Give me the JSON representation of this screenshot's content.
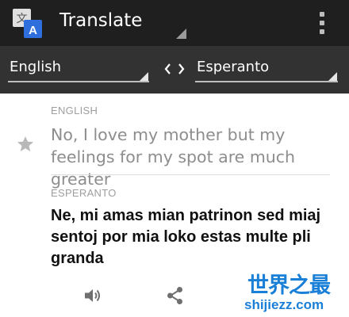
{
  "app_bar": {
    "title": "Translate",
    "icons": {
      "app": "translate-app-icon",
      "overflow": "overflow-menu-icon"
    }
  },
  "language_bar": {
    "source_language": "English",
    "target_language": "Esperanto",
    "swap_glyph": "‹ ›"
  },
  "source": {
    "label": "ENGLISH",
    "text": "No, I love my mother but my feelings for my spot are much greater",
    "star_icon": "star-icon"
  },
  "result": {
    "label": "ESPERANTO",
    "text": "Ne, mi amas mian patrinon sed miaj sentoj por mia loko estas multe pli granda",
    "actions": [
      "speaker-icon",
      "share-icon"
    ]
  },
  "watermark": {
    "brand": "世界之最",
    "url": "shijiezz.com"
  },
  "colors": {
    "app_bar": "#1f1f1f",
    "language_bar": "#323232",
    "source_text": "#8d8d8d",
    "result_text": "#111111",
    "watermark": "#1a7fd6"
  }
}
